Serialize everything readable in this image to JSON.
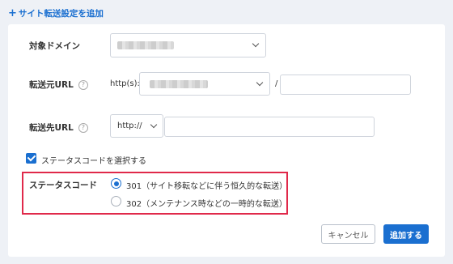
{
  "header": {
    "add_site_label": "サイト転送設定を追加",
    "plus": "+"
  },
  "form": {
    "domain": {
      "label": "対象ドメイン"
    },
    "source": {
      "label": "転送元URL",
      "protocol": "http(s)://",
      "separator": "/"
    },
    "target": {
      "label": "転送先URL",
      "protocol_selected": "http://"
    },
    "status_checkbox": {
      "label": "ステータスコードを選択する",
      "checked": true
    },
    "status_code": {
      "label": "ステータスコード",
      "options": [
        {
          "text": "301（サイト移転などに伴う恒久的な転送）",
          "selected": true
        },
        {
          "text": "302（メンテナンス時などの一時的な転送）",
          "selected": false
        }
      ]
    },
    "help_icon": "?"
  },
  "buttons": {
    "cancel": "キャンセル",
    "add": "追加する"
  },
  "colors": {
    "accent": "#1a6fd0",
    "highlight": "#e0294a",
    "background": "#eef1f6"
  }
}
